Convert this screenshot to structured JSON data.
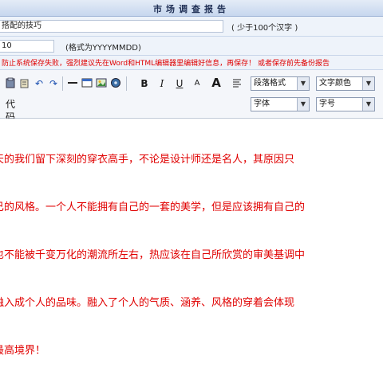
{
  "header": {
    "title": "市场调查报告"
  },
  "title_field": {
    "value": "搭配的技巧",
    "hint": "( 少于100个汉字 )"
  },
  "date_field": {
    "value": "10",
    "hint": "(格式为YYYYMMDD)"
  },
  "warning": "防止系统保存失败，强烈建议先在Word和HTML编辑器里编辑好信息，再保存！ 或者保存前先备份报告",
  "toolbar": {
    "bold": "B",
    "italic": "I",
    "underline": "U",
    "font_grow": "A",
    "font_shrink": "A",
    "undo": "↶",
    "redo": "↷",
    "paragraph_format": "段落格式",
    "font_color": "文字颜色",
    "font_family": "字体",
    "font_size": "字号",
    "source_label": "代码",
    "dropdown_arrow": "▼"
  },
  "content": {
    "lines": [
      "天的我们留下深刻的穿衣高手，不论是设计师还是名人，其原因只",
      "已的风格。一个人不能拥有自己的一套的美学，但是应该拥有自己的",
      "也不能被千变万化的潮流所左右，热应该在自己所欣赏的审美基调中",
      "融入成个人的品味。融入了个人的气质、涵养、风格的穿着会体现",
      "最高境界！"
    ]
  },
  "colors": {
    "accent_red": "#e00000",
    "title_blue": "#1f2f55"
  }
}
